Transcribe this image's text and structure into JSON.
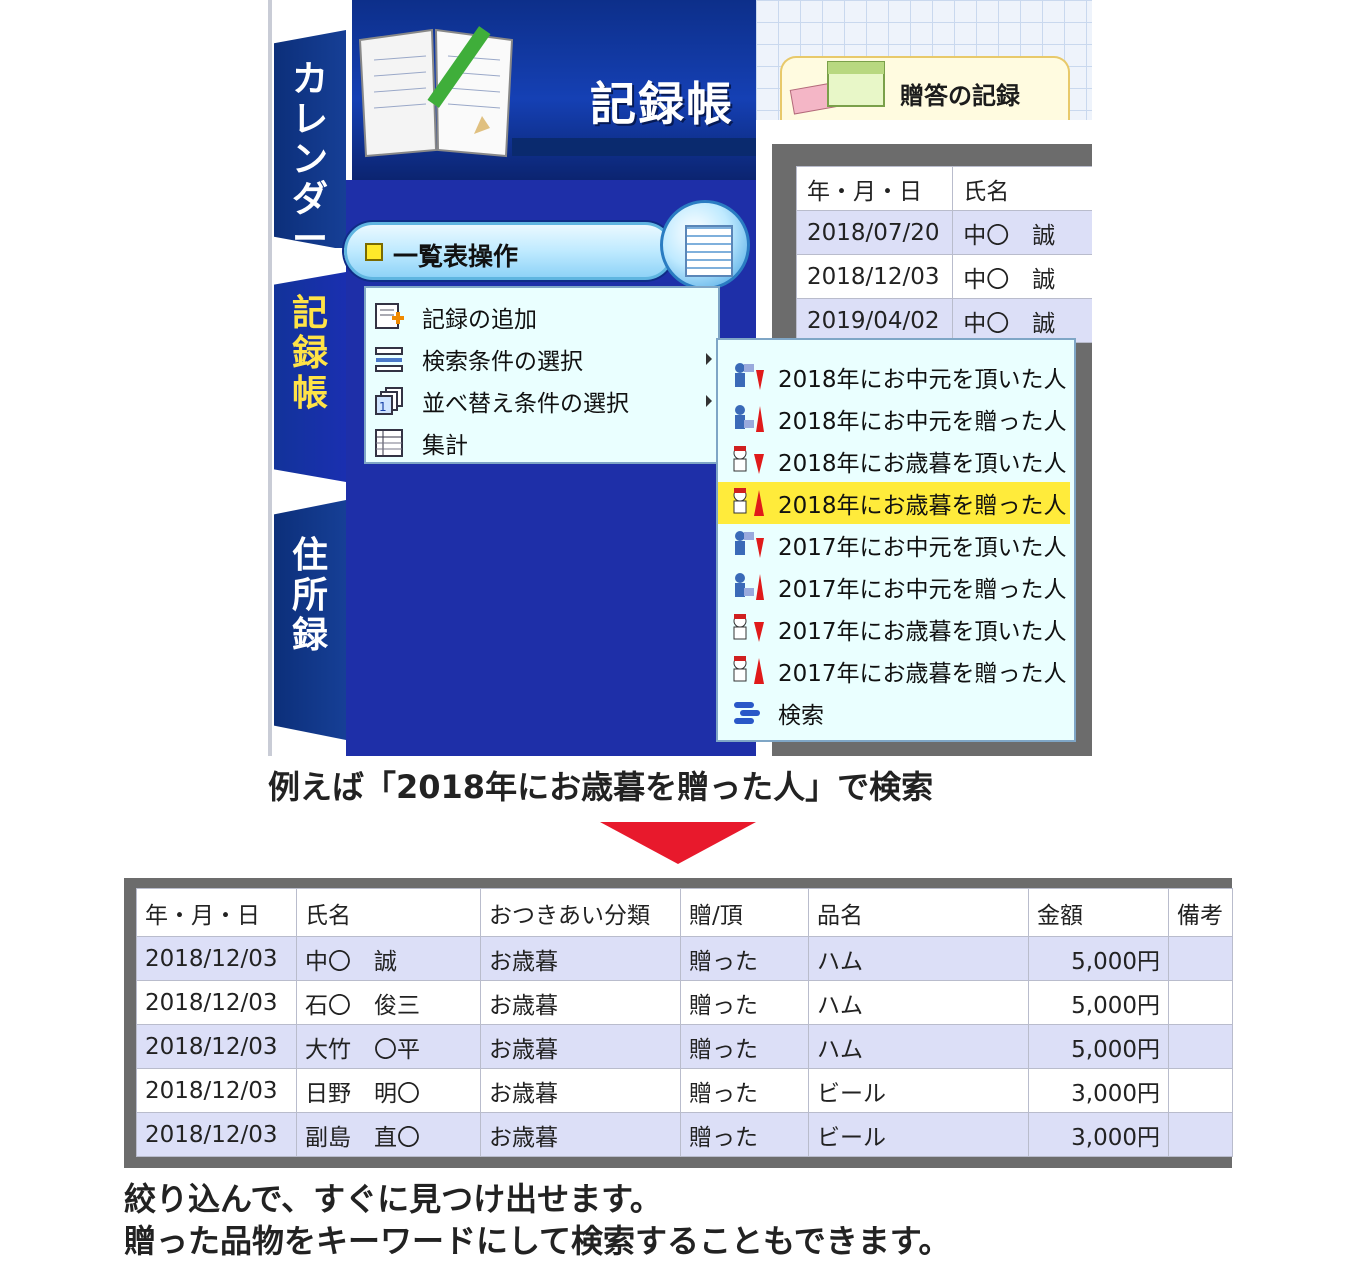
{
  "app": {
    "tabs": {
      "calendar": [
        "カ",
        "レ",
        "ン",
        "ダ",
        "ー"
      ],
      "records": [
        "記",
        "録",
        "帳"
      ],
      "address": [
        "住",
        "所",
        "録"
      ]
    },
    "header_title": "記録帳",
    "gift_tab_label": "贈答の記録",
    "background_table": {
      "header": [
        "年・月・日",
        "氏名"
      ],
      "rows": [
        [
          "2018/07/20",
          "中〇　誠"
        ],
        [
          "2018/12/03",
          "中〇　誠"
        ],
        [
          "2019/04/02",
          "中〇　誠"
        ]
      ]
    },
    "operation_menu": {
      "title": "一覧表操作",
      "items": [
        {
          "label": "記録の追加",
          "icon": "add-record-icon",
          "submenu": false
        },
        {
          "label": "検索条件の選択",
          "icon": "search-condition-icon",
          "submenu": true
        },
        {
          "label": "並べ替え条件の選択",
          "icon": "sort-condition-icon",
          "submenu": true
        },
        {
          "label": "集計",
          "icon": "summary-icon",
          "submenu": false
        }
      ]
    },
    "search_submenu": {
      "selected_index": 3,
      "items": [
        {
          "label": "2018年にお中元を頂いた人",
          "icon": "received-summer-gift-icon"
        },
        {
          "label": "2018年にお中元を贈った人",
          "icon": "sent-summer-gift-icon"
        },
        {
          "label": "2018年にお歳暮を頂いた人",
          "icon": "received-winter-gift-icon"
        },
        {
          "label": "2018年にお歳暮を贈った人",
          "icon": "sent-winter-gift-icon"
        },
        {
          "label": "2017年にお中元を頂いた人",
          "icon": "received-summer-gift-icon"
        },
        {
          "label": "2017年にお中元を贈った人",
          "icon": "sent-summer-gift-icon"
        },
        {
          "label": "2017年にお歳暮を頂いた人",
          "icon": "received-winter-gift-icon"
        },
        {
          "label": "2017年にお歳暮を贈った人",
          "icon": "sent-winter-gift-icon"
        },
        {
          "label": "検索",
          "icon": "search-icon"
        }
      ]
    },
    "colors": {
      "tab_blue": "#163f96",
      "active_tab_text": "#ffe347",
      "menu_bg": "#eaffff",
      "selected_item": "#ffeb3b",
      "row_shade": "#dcdff7"
    }
  },
  "caption_search": "例えば「2018年にお歳暮を贈った人」で検索",
  "arrow_color": "#e8192c",
  "result_table": {
    "columns": [
      "年・月・日",
      "氏名",
      "おつきあい分類",
      "贈/頂",
      "品名",
      "金額",
      "備考"
    ],
    "rows": [
      [
        "2018/12/03",
        "中〇　誠",
        "お歳暮",
        "贈った",
        "ハム",
        "5,000円",
        ""
      ],
      [
        "2018/12/03",
        "石〇　俊三",
        "お歳暮",
        "贈った",
        "ハム",
        "5,000円",
        ""
      ],
      [
        "2018/12/03",
        "大竹　〇平",
        "お歳暮",
        "贈った",
        "ハム",
        "5,000円",
        ""
      ],
      [
        "2018/12/03",
        "日野　明〇",
        "お歳暮",
        "贈った",
        "ビール",
        "3,000円",
        ""
      ],
      [
        "2018/12/03",
        "副島　直〇",
        "お歳暮",
        "贈った",
        "ビール",
        "3,000円",
        ""
      ]
    ]
  },
  "caption_bottom": [
    "絞り込んで、すぐに見つけ出せます。",
    "贈った品物をキーワードにして検索することもできます。"
  ]
}
